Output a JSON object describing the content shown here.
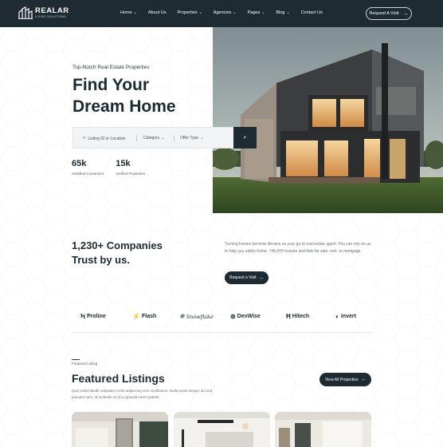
{
  "brand": {
    "name": "REALAR",
    "tagline": "LIVING SOLUTIONS"
  },
  "nav": {
    "items": [
      {
        "label": "Home",
        "dropdown": true
      },
      {
        "label": "About Us",
        "dropdown": false
      },
      {
        "label": "Properties",
        "dropdown": true
      },
      {
        "label": "Agencies",
        "dropdown": true
      },
      {
        "label": "Pages",
        "dropdown": true
      },
      {
        "label": "Blog",
        "dropdown": true
      },
      {
        "label": "Contact Us",
        "dropdown": false
      }
    ],
    "cta_label": "Request A Visit"
  },
  "hero": {
    "eyebrow": "Top-Notch Real Estate Properties",
    "title_line1": "Find Your",
    "title_line2": "Dream Home",
    "search": {
      "location_placeholder": "Listing ID or Location",
      "category_label": "Category",
      "offer_type_label": "Offer Type"
    },
    "stats": [
      {
        "value": "65k",
        "label": "Satisfied Customers"
      },
      {
        "value": "15k",
        "label": "Verified Properties"
      }
    ]
  },
  "companies": {
    "title_line1": "1,230+ Companies",
    "title_line2": "Trust by us.",
    "description": "Turning homes become dreams as your go-to real estate agent. You can rely on us to help you safely home. 745,000 houses and flats for sale, rent, or mortgage.",
    "button_label": "Request a Visit"
  },
  "logos": [
    {
      "name": "Proline",
      "icon": "proline-icon",
      "glyph": "Ϟ"
    },
    {
      "name": "Flash",
      "icon": "flash-icon",
      "glyph": "⚡"
    },
    {
      "name": "Snowflake",
      "icon": "snowflake-icon",
      "glyph": "❄"
    },
    {
      "name": "DevWise",
      "icon": "globe-icon",
      "glyph": "⊜"
    },
    {
      "name": "Hitech",
      "icon": "hitech-icon",
      "glyph": "Ħ"
    },
    {
      "name": "invert",
      "icon": "invert-icon",
      "glyph": "◐"
    }
  ],
  "featured": {
    "eyebrow": "Featured Listing",
    "title": "Featured Listings",
    "description": "Quis nulla blandit vulputate morbi adipiscing sem vestibulum. Nulla turpis integer dui sed posuere sem. Id molestie mi arcu gravida lorem potenti.",
    "button_label": "View All Properties"
  },
  "colors": {
    "primary": "#1e2b33",
    "text": "#1c2a33",
    "muted": "#66737a",
    "background": "#ffffff"
  }
}
